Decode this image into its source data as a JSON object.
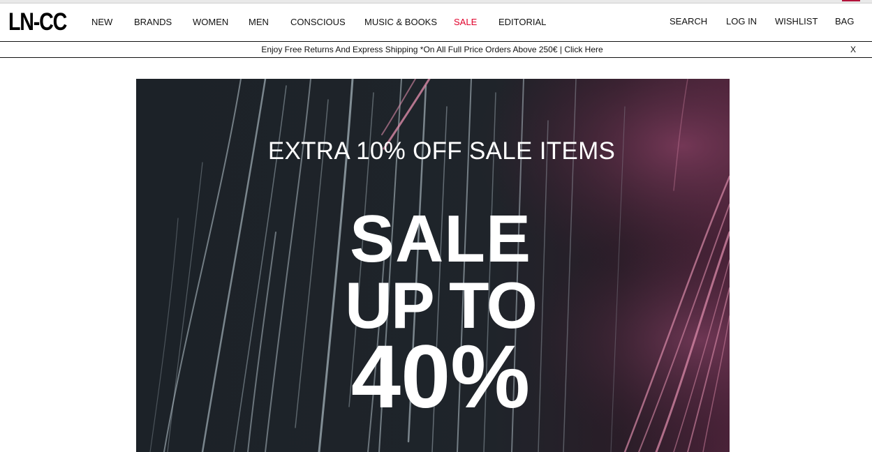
{
  "logo": {
    "text": "LN-CC"
  },
  "nav": {
    "primary": [
      {
        "label": "NEW",
        "id": "new"
      },
      {
        "label": "BRANDS",
        "id": "brands"
      },
      {
        "label": "WOMEN",
        "id": "women"
      },
      {
        "label": "MEN",
        "id": "men"
      },
      {
        "label": "CONSCIOUS",
        "id": "conscious"
      },
      {
        "label": "MUSIC & BOOKS",
        "id": "music-books"
      },
      {
        "label": "SALE",
        "id": "sale"
      },
      {
        "label": "EDITORIAL",
        "id": "editorial"
      }
    ],
    "utility": [
      {
        "label": "SEARCH",
        "id": "search"
      },
      {
        "label": "LOG IN",
        "id": "log-in"
      },
      {
        "label": "WISHLIST",
        "id": "wishlist"
      },
      {
        "label": "BAG",
        "id": "bag"
      }
    ]
  },
  "promo": {
    "text": "Enjoy Free Returns And Express Shipping *On All Full Price Orders Above 250€ | Click Here",
    "close_label": "X"
  },
  "hero": {
    "subtitle": "EXTRA 10% OFF SALE ITEMS",
    "line1": "SALE",
    "line2": "UP TO",
    "line3": "40%"
  },
  "colors": {
    "sale_accent": "#e0002a",
    "hero_background": "#1e2329",
    "hero_streak_light": "#b9c8d0",
    "hero_streak_pink": "#d98aa8"
  }
}
